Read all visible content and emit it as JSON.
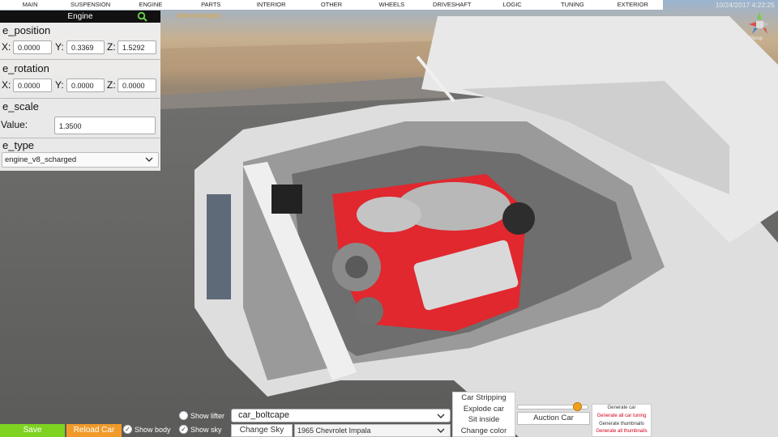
{
  "menu": {
    "tabs": [
      "MAIN",
      "SUSPENSION",
      "ENGINE",
      "PARTS",
      "INTERIOR",
      "OTHER",
      "WHEELS",
      "DRIVESHAFT",
      "LOGIC",
      "TUNING",
      "EXTERIOR"
    ],
    "datetime": "10/24/2017 4:22:25"
  },
  "viewport": {
    "selected_object_label": "Selected object",
    "persp_label": "Persp"
  },
  "panel": {
    "title": "Engine",
    "position": {
      "label": "e_position",
      "x_label": "X:",
      "y_label": "Y:",
      "z_label": "Z:",
      "x": "0.0000",
      "y": "0.3369",
      "z": "1.5292"
    },
    "rotation": {
      "label": "e_rotation",
      "x_label": "X:",
      "y_label": "Y:",
      "z_label": "Z:",
      "x": "0.0000",
      "y": "0.0000",
      "z": "0.0000"
    },
    "scale": {
      "label": "e_scale",
      "value_label": "Value:",
      "value": "1.3500"
    },
    "type": {
      "label": "e_type",
      "selected": "engine_v8_scharged"
    }
  },
  "bottom": {
    "save_label": "Save",
    "reload_label": "Reload Car",
    "show_body_label": "Show body",
    "show_sky_label": "Show sky",
    "show_lifter_label": "Show lifter",
    "car_name_value": "car_boltcape",
    "change_sky_label": "Change Sky",
    "car_model_selected": "1965 Chevrolet Impala",
    "actions": [
      "Car Stripping",
      "Explode car",
      "Sit inside",
      "Change color"
    ],
    "auction_label": "Auction Car",
    "slider_value": 0.9,
    "generate_items": [
      {
        "label": "Generate car",
        "color": "#333333"
      },
      {
        "label": "Generate all car tuning",
        "color": "#d0021b"
      },
      {
        "label": "Generate thumbnails",
        "color": "#333333"
      },
      {
        "label": "Generate all thumbnails",
        "color": "#d0021b"
      }
    ]
  },
  "colors": {
    "save": "#7ed321",
    "reload": "#f09a2a",
    "accent": "#f0a020",
    "engine_red": "#e0282e"
  }
}
